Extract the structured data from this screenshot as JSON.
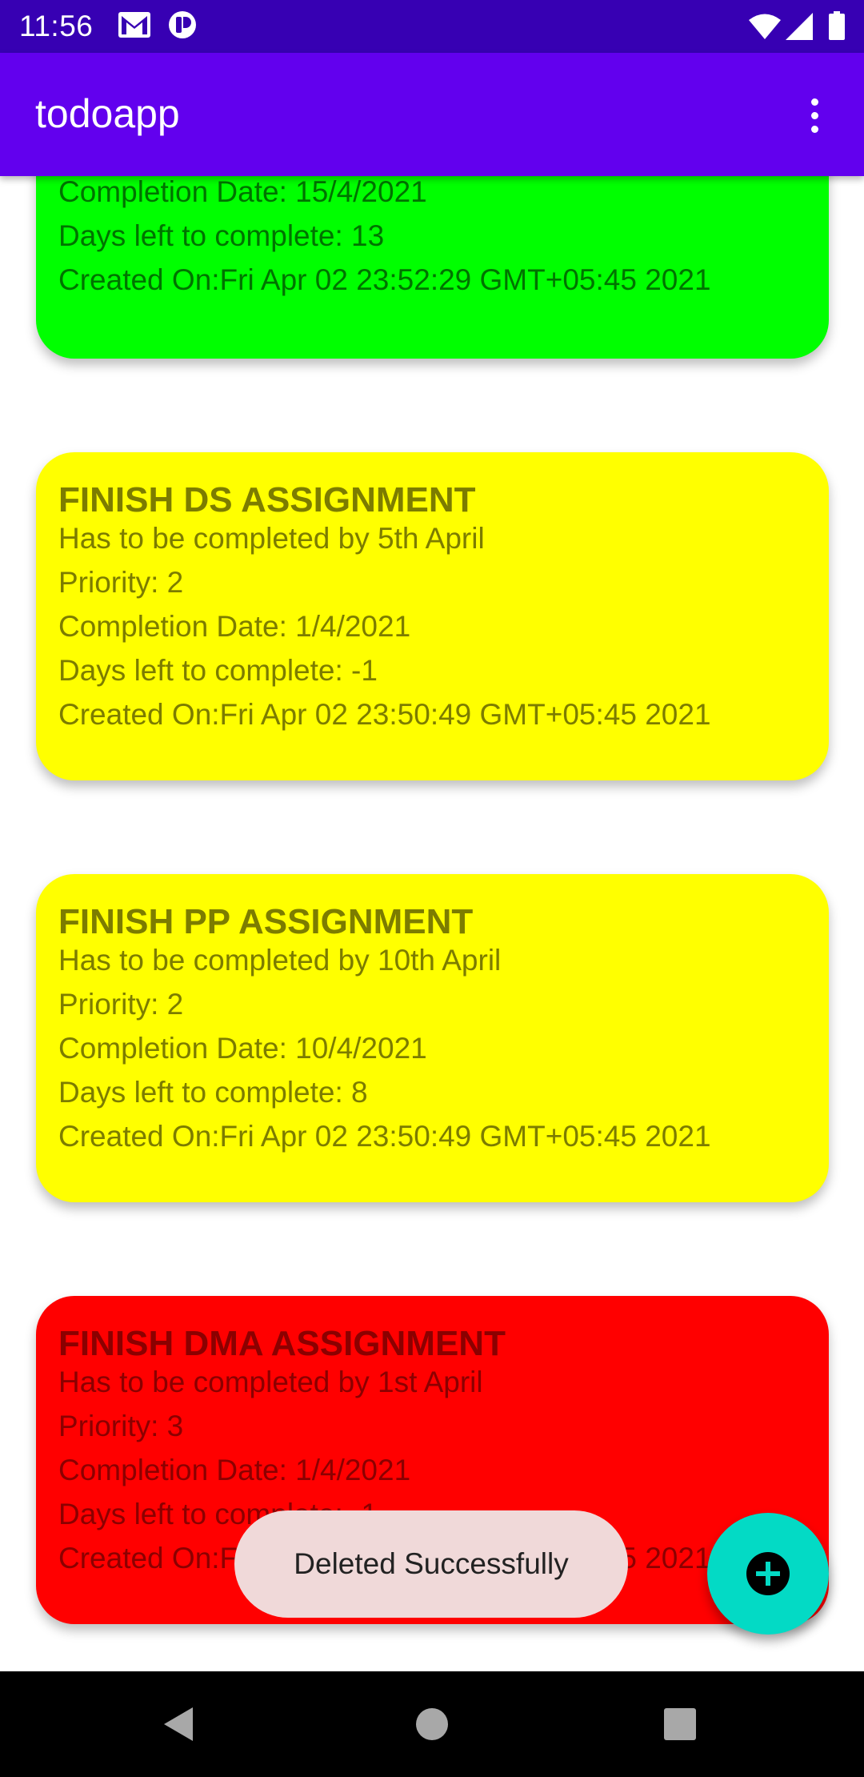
{
  "status_bar": {
    "time": "11:56",
    "icons": [
      "gmail-icon",
      "app-icon",
      "wifi-icon",
      "signal-icon",
      "battery-icon"
    ]
  },
  "app_bar": {
    "title": "todoapp",
    "menu_icon": "more-vert-icon"
  },
  "colors": {
    "status_bar": "#3700b3",
    "app_bar": "#6200ee",
    "green_card": "#00ff00",
    "yellow_card": "#ffff00",
    "red_card": "#ff0000",
    "fab": "#03dac5",
    "toast": "#f0d9d9"
  },
  "todos": [
    {
      "color": "green",
      "completion_date": "Completion Date: 15/4/2021",
      "days_left": "Days left to complete: 13",
      "created_on": "Created On:Fri Apr 02 23:52:29 GMT+05:45 2021"
    },
    {
      "color": "yellow",
      "title": "FINISH DS ASSIGNMENT",
      "description": "Has to be completed by 5th April",
      "priority": "Priority: 2",
      "completion_date": "Completion Date: 1/4/2021",
      "days_left": "Days left to complete: -1",
      "created_on": "Created On:Fri Apr 02 23:50:49 GMT+05:45 2021"
    },
    {
      "color": "yellow",
      "title": "FINISH PP ASSIGNMENT",
      "description": "Has to be completed by 10th April",
      "priority": "Priority: 2",
      "completion_date": "Completion Date: 10/4/2021",
      "days_left": "Days left to complete: 8",
      "created_on": "Created On:Fri Apr 02 23:50:49 GMT+05:45 2021"
    },
    {
      "color": "red",
      "title": "FINISH DMA ASSIGNMENT",
      "description": "Has to be completed by 1st April",
      "priority": "Priority: 3",
      "completion_date": "Completion Date: 1/4/2021",
      "days_left": "Days left to complete: -1",
      "created_on": "Created On:Fri Apr 02 23:50:49 GMT+05:45 2021"
    }
  ],
  "toast": {
    "message": "Deleted Successfully"
  },
  "fab": {
    "icon": "add-icon"
  },
  "nav_bar": {
    "icons": [
      "back-icon",
      "home-icon",
      "recents-icon"
    ]
  }
}
